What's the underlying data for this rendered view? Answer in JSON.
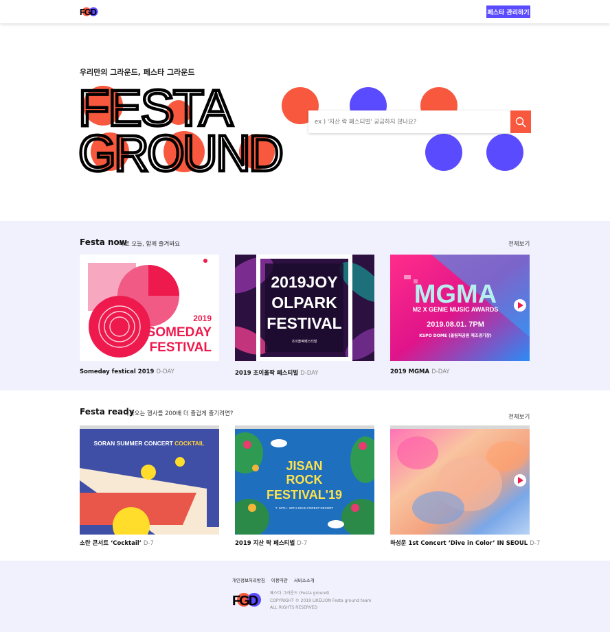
{
  "header": {
    "logo_alt": "FGD",
    "admin_button_label": "페스타 관리하기"
  },
  "hero": {
    "tagline": "우리만의 그라운드, 페스타 그라운드",
    "title_line1": "FESTA",
    "title_line2": "GROUND",
    "search_placeholder": "ex ) '지산 락 페스티벌' 궁금하지 않나요?"
  },
  "festa_now": {
    "title": "Festa now",
    "subtitle": "바로 오늘, 함께 즐겨봐요",
    "see_all": "전체보기",
    "cards": [
      {
        "name": "Someday festical 2019",
        "dday": "D-DAY",
        "poster_lines": [
          "2019",
          "SOMEDAY",
          "FESTIVAL"
        ]
      },
      {
        "name": "2019 조이올팍 페스티벌",
        "dday": "D-DAY",
        "poster_lines": [
          "2019JOY",
          "OLPARK",
          "FESTIVAL",
          "조이올팍페스티벌"
        ]
      },
      {
        "name": "2019 MGMA",
        "dday": "D-DAY",
        "poster_lines": [
          "MGMA",
          "M2 X GENIE MUSIC AWARDS",
          "2019.08.01. 7PM",
          "KSPO DOME (올림픽공원 체조경기장)"
        ]
      }
    ]
  },
  "festa_ready": {
    "title": "Festa ready",
    "subtitle": "다가오는 행사를 200배 더 즐겁게 즐기려면?",
    "see_all": "전체보기",
    "cards": [
      {
        "name": "소란 콘서트 ‘Cocktail’",
        "dday": "D-7",
        "poster_lines": [
          "SORAN SUMMER CONCERT",
          "COCKTAIL"
        ]
      },
      {
        "name": "2019 지산 락 페스티벌",
        "dday": "D-7",
        "poster_lines": [
          "JISAN",
          "ROCK",
          "FESTIVAL'19",
          "7. 26TH - 28TH JISAN FOREST RESORT"
        ]
      },
      {
        "name": "하성운 1st Concert ‘Dive in Color’ IN SEOUL",
        "dday": "D-7"
      }
    ]
  },
  "footer": {
    "links": [
      "개인정보처리방침",
      "이용약관",
      "서비스소개"
    ],
    "info_lines": [
      "페스타 그라운드 (Festa ground)",
      "COPYRIGHT © 2019 LIKELION Festa ground team",
      "ALL RIGHTS RESERVED"
    ]
  },
  "colors": {
    "accent_purple": "#5a4bff",
    "accent_red": "#f8593e",
    "section_bg": "#f1f0fd"
  },
  "icons": [
    "search-icon",
    "play-icon"
  ]
}
